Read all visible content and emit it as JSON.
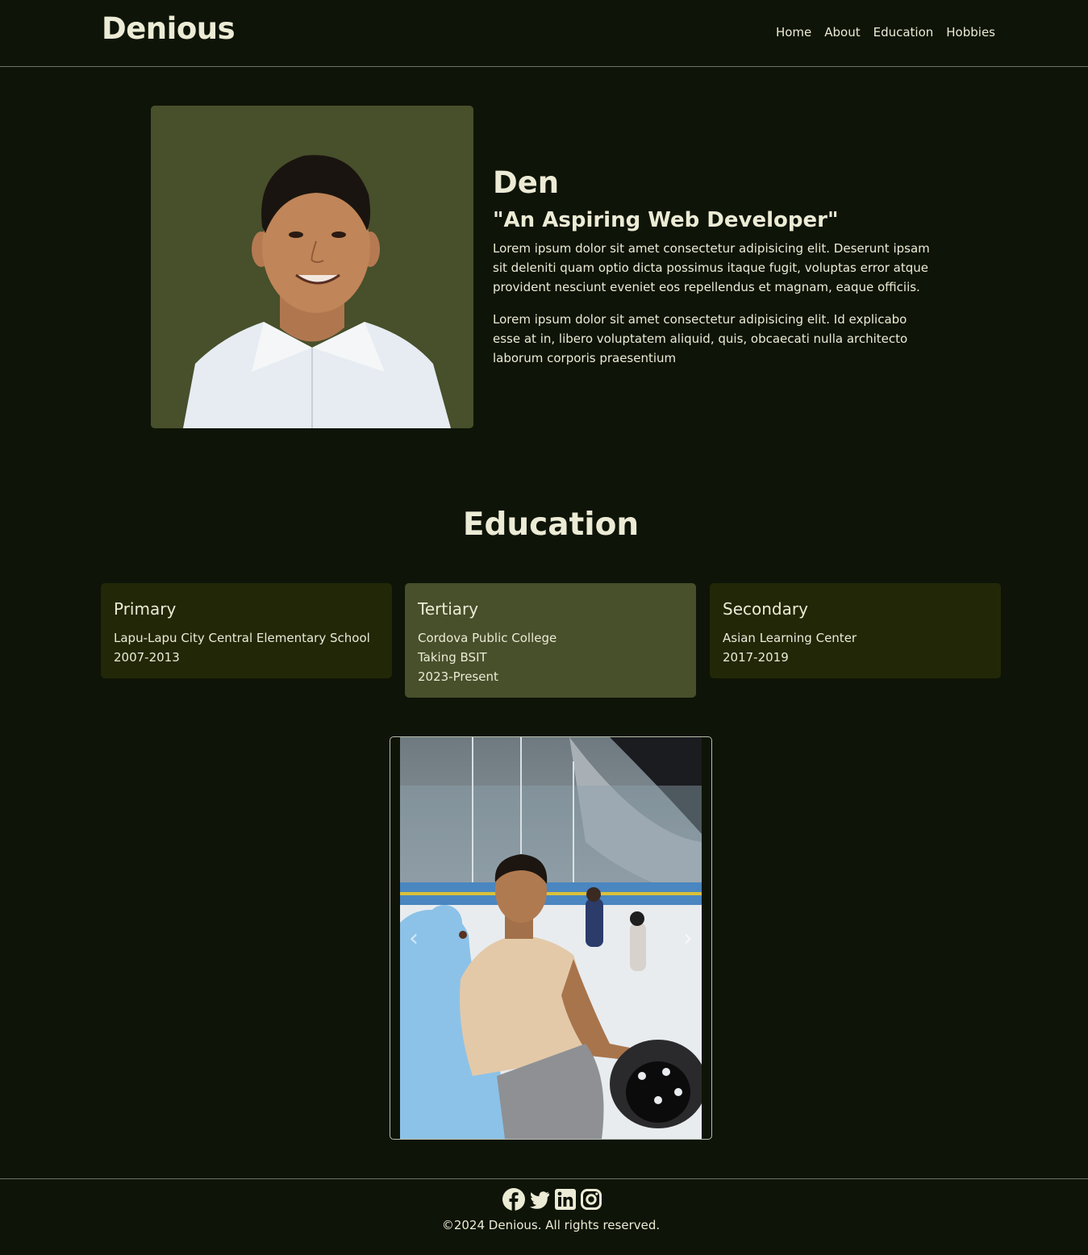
{
  "navbar": {
    "brand": "Denious",
    "links": [
      "Home",
      "About",
      "Education",
      "Hobbies"
    ]
  },
  "hero": {
    "name": "Den",
    "tagline": "\"An Aspiring Web Developer\"",
    "paragraphs": [
      "Lorem ipsum dolor sit amet consectetur adipisicing elit. Deserunt ipsam sit deleniti quam optio dicta possimus itaque fugit, voluptas error atque provident nesciunt eveniet eos repellendus et magnam, eaque officiis.",
      "Lorem ipsum dolor sit amet consectetur adipisicing elit. Id explicabo esse at in, libero voluptatem aliquid, quis, obcaecati nulla architecto laborum corporis praesentium"
    ]
  },
  "education": {
    "heading": "Education",
    "cards": [
      {
        "title": "Primary",
        "lines": [
          "Lapu-Lapu City Central Elementary School",
          "2007-2013"
        ]
      },
      {
        "title": "Tertiary",
        "lines": [
          "Cordova Public College",
          "Taking BSIT",
          "2023-Present"
        ]
      },
      {
        "title": "Secondary",
        "lines": [
          "Asian Learning Center",
          "2017-2019"
        ]
      }
    ]
  },
  "carousel": {
    "prev_icon": "chevron-left-icon",
    "next_icon": "chevron-right-icon"
  },
  "footer": {
    "social_icons": [
      "facebook-icon",
      "twitter-icon",
      "linkedin-icon",
      "instagram-icon"
    ],
    "copyright": "©2024 Denious. All rights reserved."
  },
  "colors": {
    "background": "#0e1407",
    "text": "#ecebd5",
    "card_dark": "#222708",
    "card_light": "#474f2b"
  }
}
